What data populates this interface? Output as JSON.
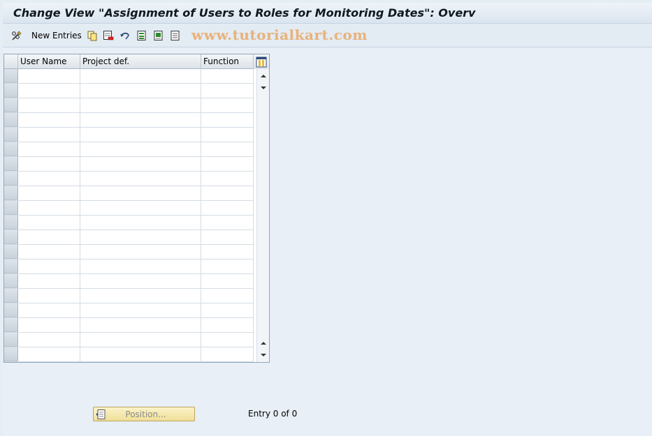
{
  "window": {
    "title": "Change View \"Assignment of Users to Roles for Monitoring Dates\": Overv"
  },
  "toolbar": {
    "new_entries_label": "New Entries",
    "watermark": "www.tutorialkart.com",
    "icons": [
      "edit-glasses-icon",
      "copy-icon",
      "delete-icon",
      "undo-icon",
      "select-all-icon",
      "select-block-icon",
      "deselect-all-icon"
    ]
  },
  "table": {
    "columns": [
      "User Name",
      "Project def.",
      "Function"
    ],
    "visible_rows": 20,
    "rows": []
  },
  "footer": {
    "position_button_label": "Position...",
    "entry_count": "Entry 0 of 0"
  },
  "colors": {
    "background": "#e5edf5",
    "watermark": "#e8b27a",
    "button_yellow": "#f0df98"
  }
}
